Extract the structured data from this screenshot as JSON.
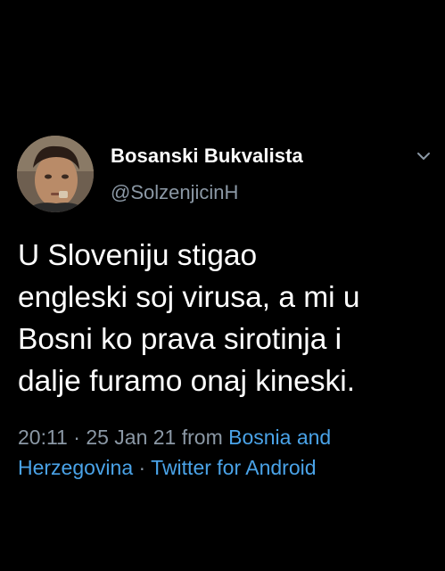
{
  "author": {
    "name": "Bosanski Bukvalista",
    "handle": "@SolzenjicinH",
    "avatar_icon": "profile-photo"
  },
  "tweet": {
    "lines": [
      "U Sloveniju stigao",
      "engleski soj virusa, a mi u",
      "Bosni ko prava sirotinja i",
      "dalje furamo onaj kineski."
    ]
  },
  "meta": {
    "time": "20:11",
    "sep1": " · ",
    "date": "25 Jan 21",
    "from_word": " from ",
    "location": "Bosnia and Herzegovina",
    "sep2": " · ",
    "source": "Twitter for Android"
  },
  "colors": {
    "background": "#000000",
    "text": "#ffffff",
    "secondary": "#8b98a5",
    "link": "#4aa3e8"
  },
  "icons": {
    "menu": "chevron-down-icon"
  }
}
